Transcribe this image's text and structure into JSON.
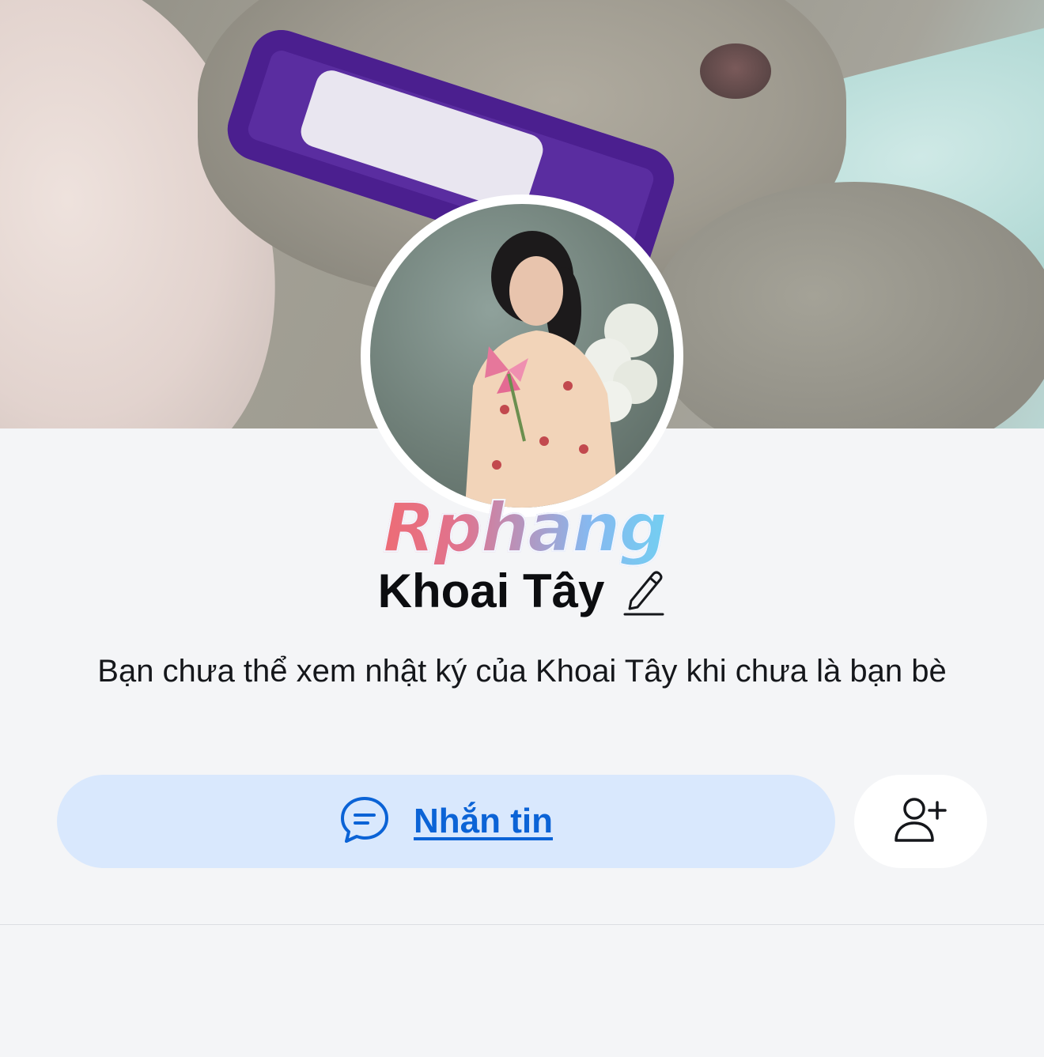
{
  "profile": {
    "name": "Khoai Tây",
    "notice": "Bạn chưa thể xem nhật ký của Khoai Tây khi chưa là bạn bè",
    "watermark": "Rphang"
  },
  "actions": {
    "message_label": "Nhắn tin",
    "message_icon": "chat-bubble-icon",
    "add_friend_icon": "add-friend-icon",
    "edit_icon": "pencil-icon"
  },
  "colors": {
    "accent": "#0b63d6",
    "message_button_bg": "#d9e8fd",
    "page_bg": "#f4f5f7"
  }
}
